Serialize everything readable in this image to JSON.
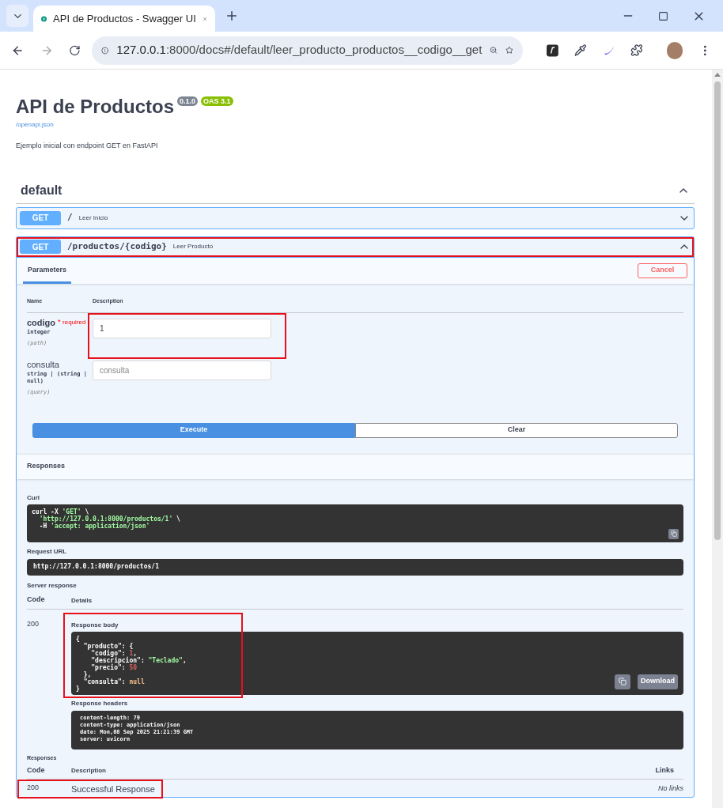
{
  "browser": {
    "tab_title": "API de Productos - Swagger UI",
    "url_host": "127.0.0.1",
    "url_rest": ":8000/docs#/default/leer_producto_productos__codigo__get"
  },
  "info": {
    "title": "API de Productos",
    "version": "0.1.0",
    "oas": "OAS 3.1",
    "spec_link": "/openapi.json",
    "description": "Ejemplo inicial con endpoint GET en FastAPI"
  },
  "tag": {
    "name": "default",
    "expanded": true
  },
  "operations": [
    {
      "method": "GET",
      "path": "/",
      "summary": "Leer Inicio",
      "expanded": false,
      "highlighted": false
    },
    {
      "method": "GET",
      "path": "/productos/{codigo}",
      "summary": "Leer Producto",
      "expanded": true,
      "highlighted": true
    }
  ],
  "parameters_panel": {
    "tab": "Parameters",
    "cancel": "Cancel",
    "columns": [
      "Name",
      "Description"
    ],
    "params": [
      {
        "name": "codigo",
        "required": true,
        "required_mark": "*",
        "required_label": "required",
        "type": "integer",
        "location": "(path)",
        "value": "1",
        "highlighted": true
      },
      {
        "name": "consulta",
        "required": false,
        "type": "string | (string | null)",
        "location": "(query)",
        "placeholder": "consulta",
        "highlighted": false
      }
    ],
    "execute": "Execute",
    "clear": "Clear"
  },
  "responses_header": "Responses",
  "curl": {
    "label": "Curl",
    "lines": [
      [
        {
          "kind": "plain",
          "text": "curl -X "
        },
        {
          "kind": "string",
          "text": "'GET'"
        },
        {
          "kind": "plain",
          "text": " \\"
        }
      ],
      [
        {
          "kind": "string",
          "text": "  'http://127.0.0.1:8000/productos/1'"
        },
        {
          "kind": "plain",
          "text": " \\"
        }
      ],
      [
        {
          "kind": "plain",
          "text": "  -H "
        },
        {
          "kind": "string",
          "text": "'accept: application/json'"
        }
      ]
    ]
  },
  "request_url": {
    "label": "Request URL",
    "value": "http://127.0.0.1:8000/productos/1"
  },
  "server_response": {
    "label": "Server response",
    "columns": [
      "Code",
      "Details"
    ],
    "code": "200",
    "body_label": "Response body",
    "body_highlighted": true,
    "body_lines": [
      [
        {
          "kind": "plain",
          "text": "{"
        }
      ],
      [
        {
          "kind": "plain",
          "text": "  \"producto\": {"
        }
      ],
      [
        {
          "kind": "plain",
          "text": "    \"codigo\": "
        },
        {
          "kind": "number",
          "text": "1"
        },
        {
          "kind": "plain",
          "text": ","
        }
      ],
      [
        {
          "kind": "plain",
          "text": "    \"descripcion\": "
        },
        {
          "kind": "string",
          "text": "\"Teclado\""
        },
        {
          "kind": "plain",
          "text": ","
        }
      ],
      [
        {
          "kind": "plain",
          "text": "    \"precio\": "
        },
        {
          "kind": "number",
          "text": "50"
        }
      ],
      [
        {
          "kind": "plain",
          "text": "  },"
        }
      ],
      [
        {
          "kind": "plain",
          "text": "  \"consulta\": "
        },
        {
          "kind": "null",
          "text": "null"
        }
      ],
      [
        {
          "kind": "plain",
          "text": "}"
        }
      ]
    ],
    "download": "Download",
    "headers_label": "Response headers",
    "headers": [
      "content-length: 79",
      "content-type: application/json",
      "date: Mon,08 Sep 2025 21:21:39 GMT",
      "server: uvicorn"
    ]
  },
  "responses": {
    "label": "Responses",
    "columns": [
      "Code",
      "Description",
      "Links"
    ],
    "rows": [
      {
        "code": "200",
        "description": "Successful Response",
        "links": "No links",
        "highlighted": true
      }
    ]
  }
}
